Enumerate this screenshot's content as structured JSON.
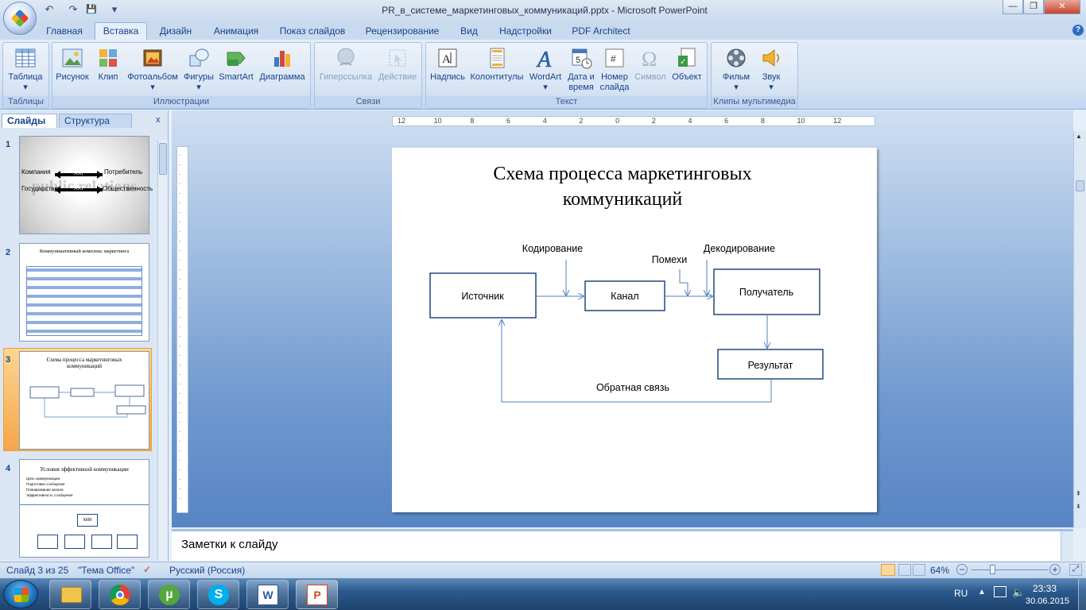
{
  "window": {
    "title": "PR_в_системе_маркетинговых_коммуникаций.pptx - Microsoft PowerPoint",
    "minimize": "—",
    "maximize": "❐",
    "close": "✕"
  },
  "qat": {
    "undo": "↶",
    "redo": "↷",
    "save": "💾",
    "more": "▾"
  },
  "tabs": [
    "Главная",
    "Вставка",
    "Дизайн",
    "Анимация",
    "Показ слайдов",
    "Рецензирование",
    "Вид",
    "Надстройки",
    "PDF Architect"
  ],
  "active_tab": "Вставка",
  "help": "?",
  "ribbon": {
    "groups": {
      "tables": "Таблицы",
      "illustrations": "Иллюстрации",
      "links": "Связи",
      "text": "Текст",
      "media": "Клипы мультимедиа"
    },
    "buttons": {
      "table": "Таблица",
      "picture": "Рисунок",
      "clip": "Клип",
      "photoalbum": "Фотоальбом",
      "shapes": "Фигуры",
      "smartart": "SmartArt",
      "chart": "Диаграмма",
      "hyperlink": "Гиперссылка",
      "action": "Действие",
      "textbox": "Надпись",
      "headerfooter": "Колонтитулы",
      "wordart": "WordArt",
      "datetime1": "Дата и",
      "datetime2": "время",
      "slidenum1": "Номер",
      "slidenum2": "слайда",
      "symbol": "Символ",
      "object": "Объект",
      "movie": "Фильм",
      "sound": "Звук"
    }
  },
  "panel": {
    "tab_slides": "Слайды",
    "tab_outline": "Структура",
    "close": "x",
    "thumbs": [
      {
        "num": "1",
        "company": "Компания",
        "consumer": "Потребитель",
        "state": "Государство",
        "society": "Общественность",
        "xxi": "XXI",
        "bg": "public relations"
      },
      {
        "num": "2",
        "title": "Коммуникативный комплекс маркетинга"
      },
      {
        "num": "3",
        "title": "Схема процесса маркетинговых коммуникаций"
      },
      {
        "num": "4",
        "title": "Условия эффективной коммуникации",
        "bullets": [
          "Цель коммуникации",
          "Подготовка сообщения",
          "Планирование канала",
          "Эффективность сообщения"
        ],
        "box": "ККМ"
      }
    ]
  },
  "ruler": {
    "labels": [
      "12",
      "10",
      "8",
      "6",
      "4",
      "2",
      "0",
      "2",
      "4",
      "6",
      "8",
      "10",
      "12"
    ]
  },
  "slide": {
    "title1": "Схема процесса маркетинговых",
    "title2": "коммуникаций",
    "nodes": {
      "source": "Источник",
      "channel": "Канал",
      "receiver": "Получатель",
      "result": "Результат"
    },
    "labels": {
      "encoding": "Кодирование",
      "decoding": "Декодирование",
      "noise": "Помехи",
      "feedback": "Обратная связь"
    }
  },
  "notes": {
    "placeholder": "Заметки к слайду"
  },
  "status": {
    "slide": "Слайд 3 из 25",
    "theme": "\"Тема Office\"",
    "language": "Русский (Россия)",
    "zoom": "64%"
  },
  "taskbar": {
    "lang": "RU",
    "time": "23:33",
    "date": "30.06.2015"
  },
  "colors": {
    "accent": "#1f497d",
    "arrow": "#4f81bd",
    "ribbon": "#d3e1f3",
    "work": "#6f99cf"
  }
}
